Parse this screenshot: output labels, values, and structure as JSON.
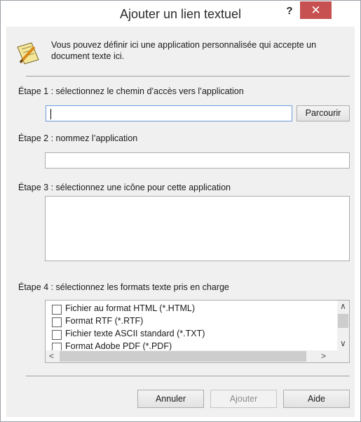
{
  "window": {
    "title": "Ajouter un lien textuel",
    "help_label": "?",
    "close_label": "✕"
  },
  "intro": {
    "icon": "notepad-pencil-icon",
    "text": "Vous pouvez définir ici une application personnalisée qui accepte un document texte ici."
  },
  "step1": {
    "label": "Étape 1 : sélectionnez le chemin d’accès vers l’application",
    "path_value": "",
    "browse_label": "Parcourir"
  },
  "step2": {
    "label": "Étape 2 : nommez l’application",
    "name_value": ""
  },
  "step3": {
    "label": "Étape 3 : sélectionnez une icône pour cette application"
  },
  "step4": {
    "label": "Étape 4 : sélectionnez les formats texte pris en charge",
    "formats": [
      {
        "label": "Fichier au format HTML (*.HTML)",
        "checked": false
      },
      {
        "label": "Format RTF (*.RTF)",
        "checked": false
      },
      {
        "label": "Fichier texte ASCII standard (*.TXT)",
        "checked": false
      },
      {
        "label": "Format Adobe PDF (*.PDF)",
        "checked": false
      }
    ]
  },
  "footer": {
    "cancel_label": "Annuler",
    "add_label": "Ajouter",
    "help_label": "Aide"
  },
  "colors": {
    "close_button": "#c75050",
    "content_bg": "#f0f0f0",
    "focus_border": "#6a9bd6"
  }
}
